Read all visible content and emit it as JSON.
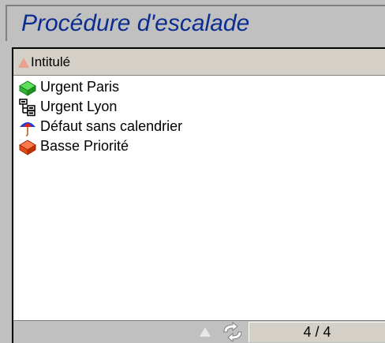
{
  "window": {
    "title": "Procédure d'escalade"
  },
  "list": {
    "column_header": "Intitulé",
    "sort_indicator_icon": "sort-ascending-triangle",
    "items": [
      {
        "label": "Urgent Paris",
        "icon": "green-box-icon"
      },
      {
        "label": "Urgent Lyon",
        "icon": "hierarchy-icon"
      },
      {
        "label": "Défaut sans calendrier",
        "icon": "umbrella-icon"
      },
      {
        "label": "Basse Priorité",
        "icon": "red-box-icon"
      }
    ]
  },
  "pager": {
    "count_text": "4 / 4",
    "up_icon": "triangle-up-icon",
    "nav_icon": "arrows-icon"
  },
  "colors": {
    "title_text": "#0b2d8f",
    "chrome": "#c0c0c0",
    "header": "#d4d0c8"
  }
}
